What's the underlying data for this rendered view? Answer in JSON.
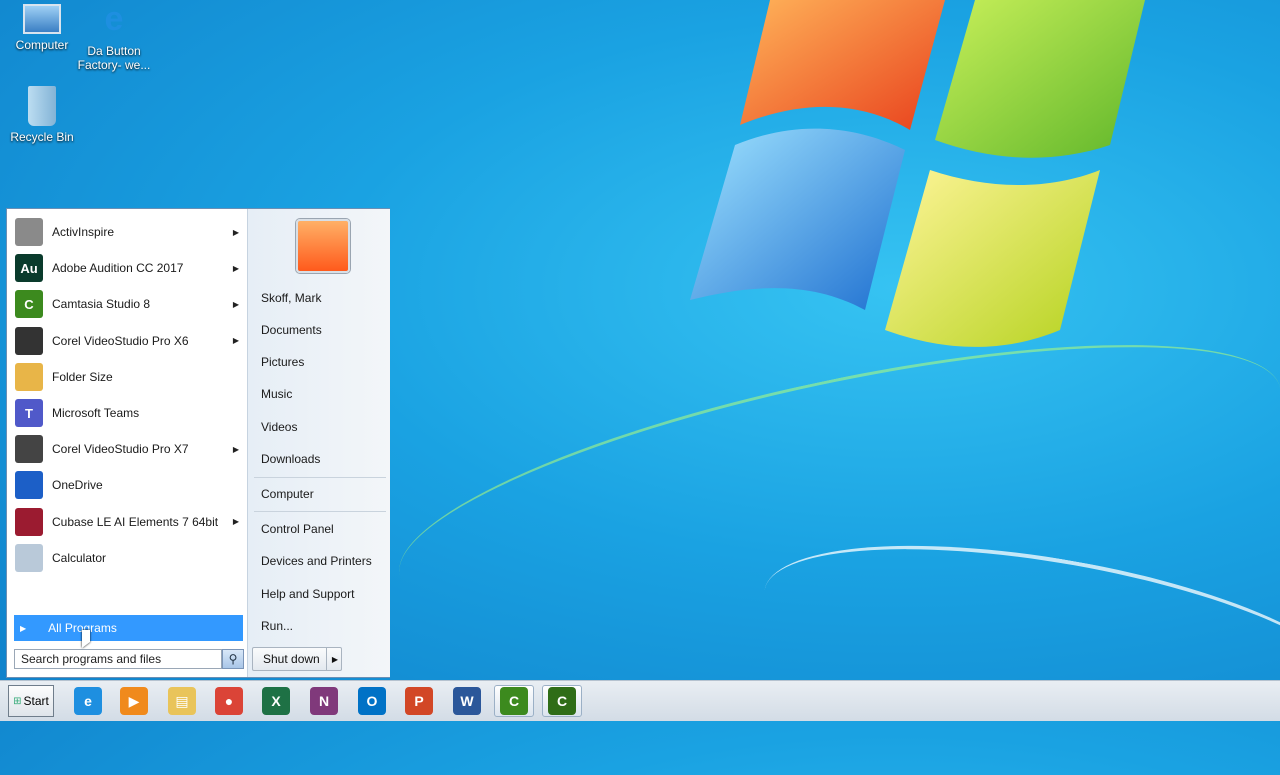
{
  "desktop": {
    "icons": [
      {
        "label": "Computer",
        "icon": "computer-icon"
      },
      {
        "label": "Da Button Factory- we...",
        "icon": "internet-explorer-shortcut-icon"
      },
      {
        "label": "Recycle Bin",
        "icon": "recycle-bin-icon"
      }
    ]
  },
  "start_menu": {
    "programs": [
      {
        "label": "ActivInspire",
        "icon": "activinspire-icon",
        "submenu": true,
        "color": "#8a8a8a"
      },
      {
        "label": "Adobe Audition CC 2017",
        "icon": "adobe-audition-icon",
        "submenu": true,
        "color": "#0a3b2c",
        "glyph": "Au"
      },
      {
        "label": "Camtasia Studio 8",
        "icon": "camtasia-icon",
        "submenu": true,
        "color": "#3c8a1e",
        "glyph": "C"
      },
      {
        "label": "Corel VideoStudio Pro X6",
        "icon": "corel-videostudio-x6-icon",
        "submenu": true,
        "color": "#333333"
      },
      {
        "label": "Folder Size",
        "icon": "folder-size-icon",
        "submenu": false,
        "color": "#e8b548"
      },
      {
        "label": "Microsoft Teams",
        "icon": "microsoft-teams-icon",
        "submenu": false,
        "color": "#5059c9",
        "glyph": "T"
      },
      {
        "label": "Corel VideoStudio Pro X7",
        "icon": "corel-videostudio-x7-icon",
        "submenu": true,
        "color": "#444444"
      },
      {
        "label": "OneDrive",
        "icon": "onedrive-icon",
        "submenu": false,
        "color": "#1c5fc7"
      },
      {
        "label": "Cubase LE AI Elements 7 64bit",
        "icon": "cubase-icon",
        "submenu": true,
        "color": "#9b1b30"
      },
      {
        "label": "Calculator",
        "icon": "calculator-icon",
        "submenu": false,
        "color": "#b9c9d9"
      }
    ],
    "all_programs_label": "All Programs",
    "search_placeholder": "Search programs and files",
    "right_items": {
      "user": "Skoff, Mark",
      "documents": "Documents",
      "pictures": "Pictures",
      "music": "Music",
      "videos": "Videos",
      "downloads": "Downloads",
      "computer": "Computer",
      "control_panel": "Control Panel",
      "devices_printers": "Devices and Printers",
      "help_support": "Help and Support",
      "run": "Run..."
    },
    "shutdown_label": "Shut down"
  },
  "taskbar": {
    "start_label": "Start",
    "apps": [
      {
        "icon": "internet-explorer-icon",
        "color": "#1e8fe0",
        "glyph": "e"
      },
      {
        "icon": "media-player-icon",
        "color": "#f08a1c",
        "glyph": "▶"
      },
      {
        "icon": "file-explorer-icon",
        "color": "#e9c45a",
        "glyph": "▤"
      },
      {
        "icon": "chrome-icon",
        "color": "#db4437",
        "glyph": "●"
      },
      {
        "icon": "excel-icon",
        "color": "#1e7145",
        "glyph": "X"
      },
      {
        "icon": "onenote-icon",
        "color": "#80397b",
        "glyph": "N"
      },
      {
        "icon": "outlook-icon",
        "color": "#0072c6",
        "glyph": "O"
      },
      {
        "icon": "powerpoint-icon",
        "color": "#d24726",
        "glyph": "P"
      },
      {
        "icon": "word-icon",
        "color": "#2b579a",
        "glyph": "W"
      },
      {
        "icon": "camtasia-taskbar-icon",
        "color": "#3c8a1e",
        "glyph": "C"
      },
      {
        "icon": "camtasia-recorder-taskbar-icon",
        "color": "#2f6d17",
        "glyph": "C"
      }
    ]
  }
}
